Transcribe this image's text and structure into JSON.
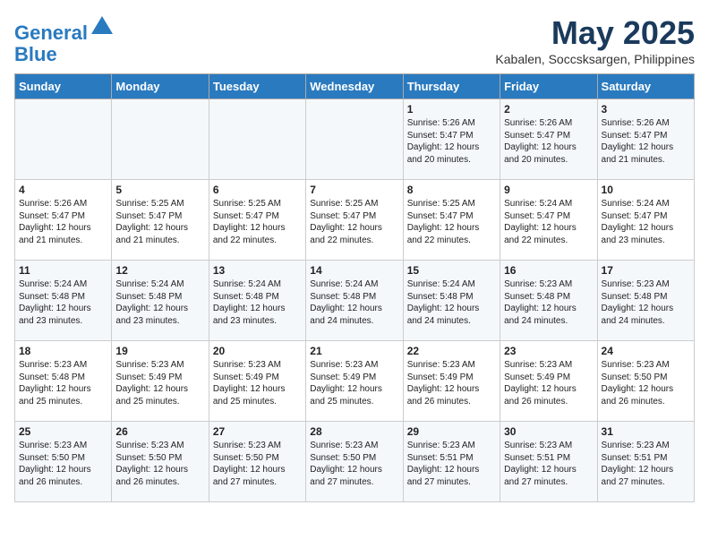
{
  "header": {
    "logo_line1": "General",
    "logo_line2": "Blue",
    "title": "May 2025",
    "subtitle": "Kabalen, Soccsksargen, Philippines"
  },
  "weekdays": [
    "Sunday",
    "Monday",
    "Tuesday",
    "Wednesday",
    "Thursday",
    "Friday",
    "Saturday"
  ],
  "weeks": [
    [
      {
        "day": "",
        "content": ""
      },
      {
        "day": "",
        "content": ""
      },
      {
        "day": "",
        "content": ""
      },
      {
        "day": "",
        "content": ""
      },
      {
        "day": "1",
        "content": "Sunrise: 5:26 AM\nSunset: 5:47 PM\nDaylight: 12 hours\nand 20 minutes."
      },
      {
        "day": "2",
        "content": "Sunrise: 5:26 AM\nSunset: 5:47 PM\nDaylight: 12 hours\nand 20 minutes."
      },
      {
        "day": "3",
        "content": "Sunrise: 5:26 AM\nSunset: 5:47 PM\nDaylight: 12 hours\nand 21 minutes."
      }
    ],
    [
      {
        "day": "4",
        "content": "Sunrise: 5:26 AM\nSunset: 5:47 PM\nDaylight: 12 hours\nand 21 minutes."
      },
      {
        "day": "5",
        "content": "Sunrise: 5:25 AM\nSunset: 5:47 PM\nDaylight: 12 hours\nand 21 minutes."
      },
      {
        "day": "6",
        "content": "Sunrise: 5:25 AM\nSunset: 5:47 PM\nDaylight: 12 hours\nand 22 minutes."
      },
      {
        "day": "7",
        "content": "Sunrise: 5:25 AM\nSunset: 5:47 PM\nDaylight: 12 hours\nand 22 minutes."
      },
      {
        "day": "8",
        "content": "Sunrise: 5:25 AM\nSunset: 5:47 PM\nDaylight: 12 hours\nand 22 minutes."
      },
      {
        "day": "9",
        "content": "Sunrise: 5:24 AM\nSunset: 5:47 PM\nDaylight: 12 hours\nand 22 minutes."
      },
      {
        "day": "10",
        "content": "Sunrise: 5:24 AM\nSunset: 5:47 PM\nDaylight: 12 hours\nand 23 minutes."
      }
    ],
    [
      {
        "day": "11",
        "content": "Sunrise: 5:24 AM\nSunset: 5:48 PM\nDaylight: 12 hours\nand 23 minutes."
      },
      {
        "day": "12",
        "content": "Sunrise: 5:24 AM\nSunset: 5:48 PM\nDaylight: 12 hours\nand 23 minutes."
      },
      {
        "day": "13",
        "content": "Sunrise: 5:24 AM\nSunset: 5:48 PM\nDaylight: 12 hours\nand 23 minutes."
      },
      {
        "day": "14",
        "content": "Sunrise: 5:24 AM\nSunset: 5:48 PM\nDaylight: 12 hours\nand 24 minutes."
      },
      {
        "day": "15",
        "content": "Sunrise: 5:24 AM\nSunset: 5:48 PM\nDaylight: 12 hours\nand 24 minutes."
      },
      {
        "day": "16",
        "content": "Sunrise: 5:23 AM\nSunset: 5:48 PM\nDaylight: 12 hours\nand 24 minutes."
      },
      {
        "day": "17",
        "content": "Sunrise: 5:23 AM\nSunset: 5:48 PM\nDaylight: 12 hours\nand 24 minutes."
      }
    ],
    [
      {
        "day": "18",
        "content": "Sunrise: 5:23 AM\nSunset: 5:48 PM\nDaylight: 12 hours\nand 25 minutes."
      },
      {
        "day": "19",
        "content": "Sunrise: 5:23 AM\nSunset: 5:49 PM\nDaylight: 12 hours\nand 25 minutes."
      },
      {
        "day": "20",
        "content": "Sunrise: 5:23 AM\nSunset: 5:49 PM\nDaylight: 12 hours\nand 25 minutes."
      },
      {
        "day": "21",
        "content": "Sunrise: 5:23 AM\nSunset: 5:49 PM\nDaylight: 12 hours\nand 25 minutes."
      },
      {
        "day": "22",
        "content": "Sunrise: 5:23 AM\nSunset: 5:49 PM\nDaylight: 12 hours\nand 26 minutes."
      },
      {
        "day": "23",
        "content": "Sunrise: 5:23 AM\nSunset: 5:49 PM\nDaylight: 12 hours\nand 26 minutes."
      },
      {
        "day": "24",
        "content": "Sunrise: 5:23 AM\nSunset: 5:50 PM\nDaylight: 12 hours\nand 26 minutes."
      }
    ],
    [
      {
        "day": "25",
        "content": "Sunrise: 5:23 AM\nSunset: 5:50 PM\nDaylight: 12 hours\nand 26 minutes."
      },
      {
        "day": "26",
        "content": "Sunrise: 5:23 AM\nSunset: 5:50 PM\nDaylight: 12 hours\nand 26 minutes."
      },
      {
        "day": "27",
        "content": "Sunrise: 5:23 AM\nSunset: 5:50 PM\nDaylight: 12 hours\nand 27 minutes."
      },
      {
        "day": "28",
        "content": "Sunrise: 5:23 AM\nSunset: 5:50 PM\nDaylight: 12 hours\nand 27 minutes."
      },
      {
        "day": "29",
        "content": "Sunrise: 5:23 AM\nSunset: 5:51 PM\nDaylight: 12 hours\nand 27 minutes."
      },
      {
        "day": "30",
        "content": "Sunrise: 5:23 AM\nSunset: 5:51 PM\nDaylight: 12 hours\nand 27 minutes."
      },
      {
        "day": "31",
        "content": "Sunrise: 5:23 AM\nSunset: 5:51 PM\nDaylight: 12 hours\nand 27 minutes."
      }
    ]
  ]
}
